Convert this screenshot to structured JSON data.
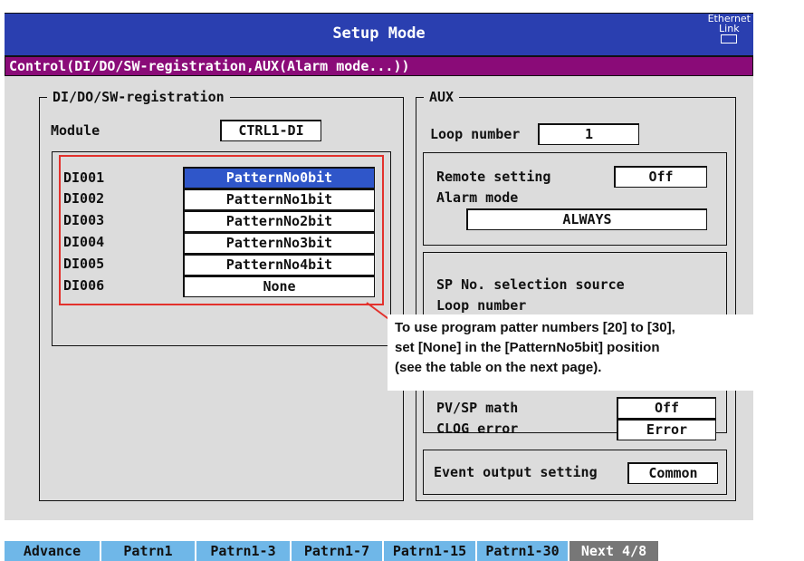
{
  "titlebar": {
    "title": "Setup Mode",
    "ethernet": "Ethernet",
    "link": "Link"
  },
  "section": {
    "path": "Control(DI/DO/SW-registration,AUX(Alarm mode...))"
  },
  "left_group": {
    "legend": "DI/DO/SW-registration",
    "module_label": "Module",
    "module_value": "CTRL1-DI",
    "rows": [
      {
        "label": "DI001",
        "value": "PatternNo0bit",
        "selected": true
      },
      {
        "label": "DI002",
        "value": "PatternNo1bit"
      },
      {
        "label": "DI003",
        "value": "PatternNo2bit"
      },
      {
        "label": "DI004",
        "value": "PatternNo3bit"
      },
      {
        "label": "DI005",
        "value": "PatternNo4bit"
      },
      {
        "label": "DI006",
        "value": "None"
      }
    ]
  },
  "right_group": {
    "legend": "AUX",
    "loop_number_label": "Loop number",
    "loop_number_value": "1",
    "remote_setting_label": "Remote setting",
    "remote_setting_value": "Off",
    "alarm_mode_label": "Alarm mode",
    "alarm_mode_value": "ALWAYS",
    "sp_source_label": "SP No. selection source",
    "sp_loop_label": "Loop number",
    "pv_sp_math_label": "PV/SP math",
    "pv_sp_math_value": "Off",
    "clog_error_label": "CLOG error",
    "clog_error_value": "Error",
    "event_output_label": "Event output setting",
    "event_output_value": "Common"
  },
  "callout": {
    "line1": "To use program patter numbers [20] to [30],",
    "line2": "set [None] in the [PatternNo5bit] position",
    "line3": "(see the table on the next page)."
  },
  "softkeys": [
    "Advance",
    "Patrn1",
    "Patrn1-3",
    "Patrn1-7",
    "Patrn1-15",
    "Patrn1-30",
    "Next 4/8"
  ],
  "colors": {
    "title_bg": "#2a3fb0",
    "section_bg": "#8a0b78",
    "softkey_bg": "#6fb7e8",
    "highlight": "#e3312c"
  }
}
